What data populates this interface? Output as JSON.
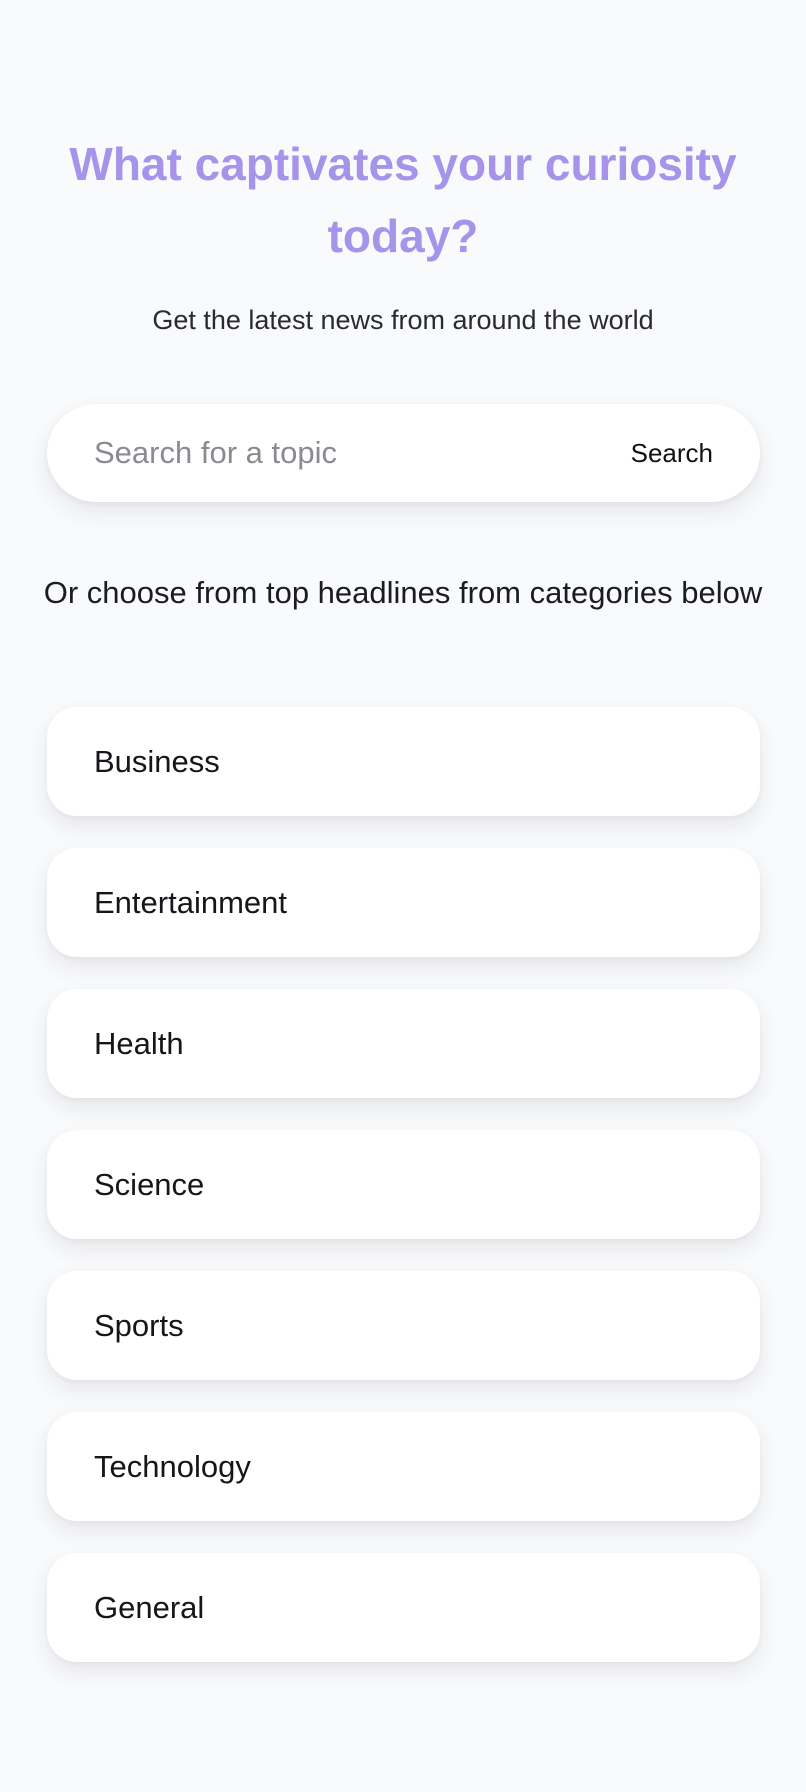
{
  "header": {
    "title": "What captivates your curiosity today?",
    "subtitle": "Get the latest news from around the world"
  },
  "search": {
    "placeholder": "Search for a topic",
    "value": "",
    "button_label": "Search"
  },
  "categories": {
    "prompt": "Or choose from top headlines from categories below",
    "items": [
      {
        "label": "Business"
      },
      {
        "label": "Entertainment"
      },
      {
        "label": "Health"
      },
      {
        "label": "Science"
      },
      {
        "label": "Sports"
      },
      {
        "label": "Technology"
      },
      {
        "label": "General"
      }
    ]
  },
  "colors": {
    "background": "#f9fafc",
    "title_accent": "#a693ea",
    "card": "#ffffff",
    "text": "#1b1b20"
  }
}
